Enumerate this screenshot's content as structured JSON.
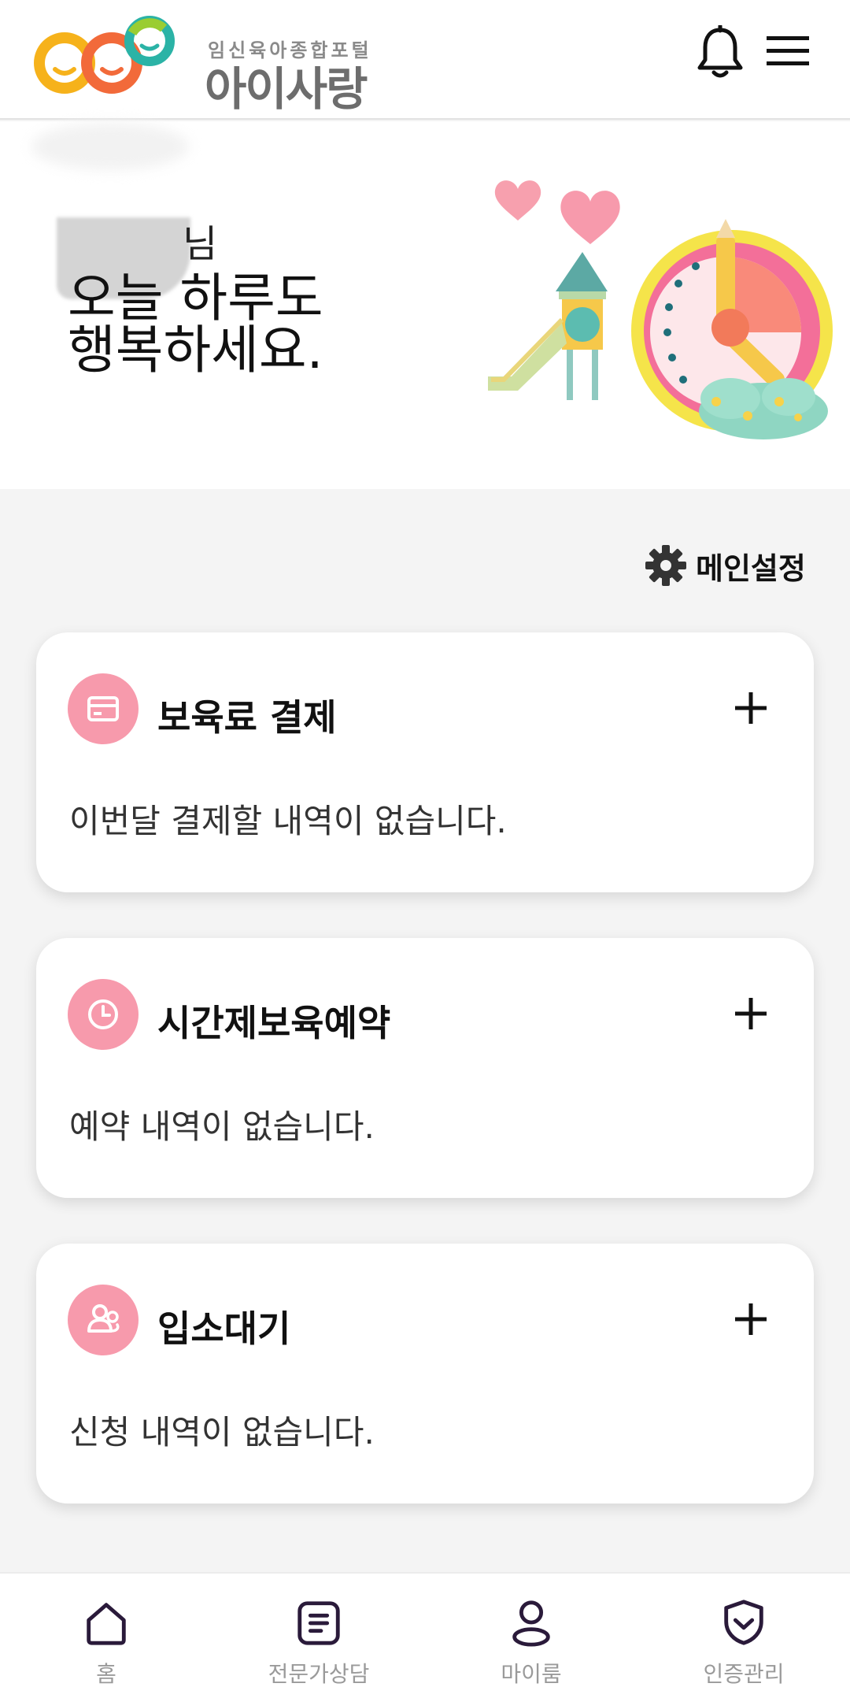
{
  "header": {
    "logo_sub": "임신육아종합포털",
    "logo_main": "아이사랑"
  },
  "hero": {
    "name_suffix": "님",
    "greeting": "오늘 하루도\n행복하세요."
  },
  "settings": {
    "label": "메인설정"
  },
  "cards": [
    {
      "title": "보육료 결제",
      "body": "이번달 결제할 내역이 없습니다.",
      "icon": "card-icon"
    },
    {
      "title": "시간제보육예약",
      "body": "예약 내역이 없습니다.",
      "icon": "clock-icon"
    },
    {
      "title": "입소대기",
      "body": "신청 내역이 없습니다.",
      "icon": "people-icon"
    }
  ],
  "nav": {
    "items": [
      {
        "label": "홈",
        "icon": "home-icon"
      },
      {
        "label": "전문가상담",
        "icon": "document-icon"
      },
      {
        "label": "마이룸",
        "icon": "person-icon"
      },
      {
        "label": "인증관리",
        "icon": "shield-icon"
      }
    ]
  },
  "colors": {
    "accent_pink": "#f79aac",
    "background": "#f4f4f4",
    "nav_icon": "#2a1a3a"
  }
}
